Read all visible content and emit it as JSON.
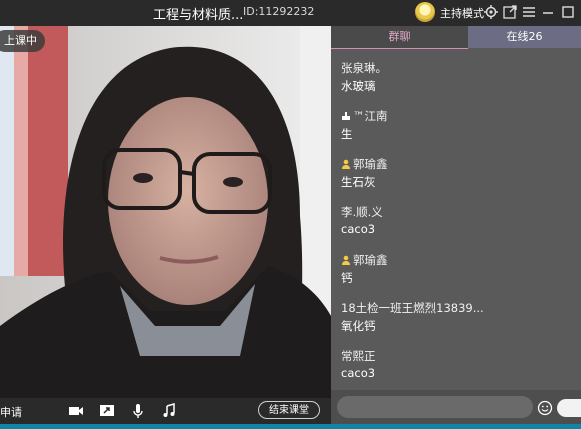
{
  "title_bar": {
    "title": "工程与材料质...",
    "room_id": "ID:11292232",
    "host_mode": "主持模式",
    "icons": [
      "host-avatar",
      "settings-icon",
      "popout-icon",
      "menu-icon",
      "minimize-icon",
      "maximize-icon"
    ]
  },
  "video": {
    "live_badge": "上课中",
    "apply_label": "申请",
    "toolbar_icons": [
      "camera-icon",
      "screen-share-icon",
      "microphone-icon",
      "music-icon"
    ],
    "end_class_label": "结束课堂"
  },
  "chat": {
    "tabs": {
      "group": "群聊",
      "online": "在线26"
    },
    "messages": [
      {
        "name": "张泉琳。",
        "text": "水玻璃",
        "badge": ""
      },
      {
        "name": "™江南",
        "text": "生",
        "badge": "cake"
      },
      {
        "name": "郭瑜鑫",
        "text": "生石灰",
        "badge": "person"
      },
      {
        "name": "李.顺.义",
        "text": "caco3",
        "badge": ""
      },
      {
        "name": "郭瑜鑫",
        "text": "钙",
        "badge": "person"
      },
      {
        "name": "18土检一班王燃烈13839...",
        "text": "氧化钙",
        "badge": ""
      },
      {
        "name": "常熙正",
        "text": "caco3",
        "badge": ""
      }
    ],
    "input_placeholder": ""
  },
  "colors": {
    "title_bar_bg": "#2a2a2a",
    "chat_bg": "#5a5a5a",
    "active_tab_text": "#e0a7c7",
    "online_tab_bg": "#6c6c84",
    "bottom_strip": "#0f86a5"
  }
}
